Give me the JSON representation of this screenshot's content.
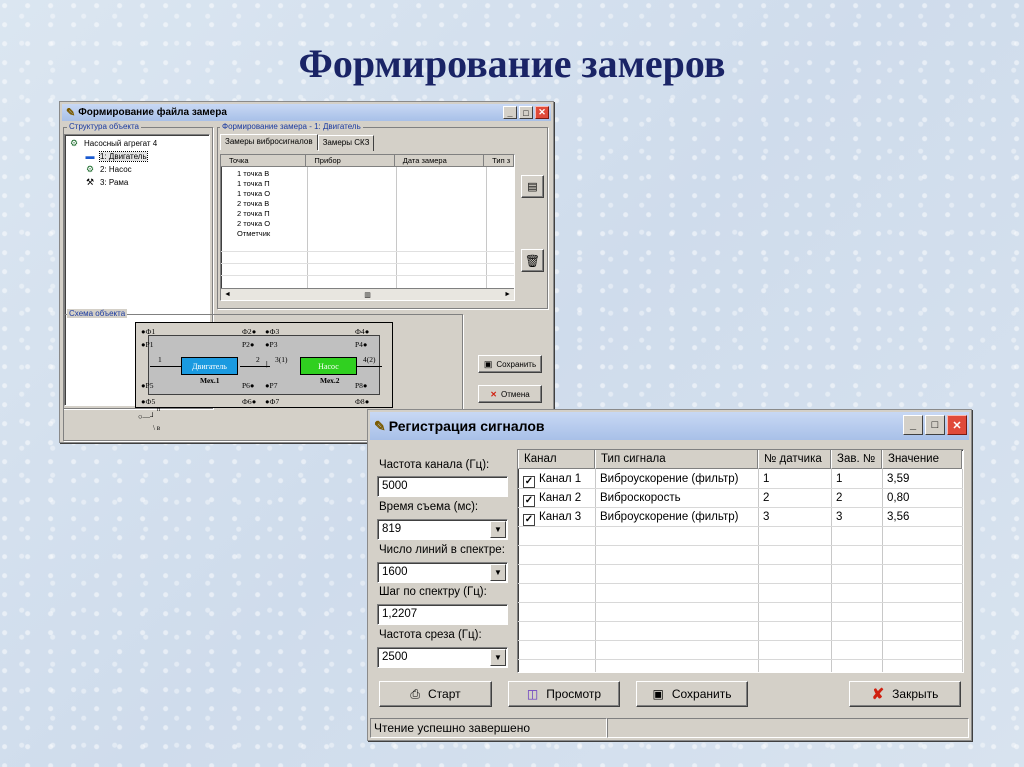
{
  "slide": {
    "title": "Формирование замеров"
  },
  "window1": {
    "title": "Формирование файла замера",
    "structure_label": "Структура объекта",
    "tree": {
      "root": "Насосный агрегат 4",
      "children": [
        "1: Двигатель",
        "2: Насос",
        "3: Рама"
      ]
    },
    "form_label": "Формирование замера -  1: Двигатель",
    "tabs": [
      "Замеры вибросигналов",
      "Замеры СКЗ"
    ],
    "grid_headers": [
      "Точка",
      "Прибор",
      "Дата замера",
      "Тип з"
    ],
    "points": [
      "1 точка В",
      "1 точка П",
      "1 точка О",
      "2 точка В",
      "2 точка П",
      "2 точка О",
      "Отметчик"
    ],
    "scheme_label": "Схема объекта",
    "scheme": {
      "top_labels": [
        "Ф1",
        "Ф2",
        "Ф3",
        "Ф4"
      ],
      "p_top": [
        "P1",
        "P2",
        "P3",
        "P4"
      ],
      "p_bottom": [
        "P5",
        "P6",
        "P7",
        "P8"
      ],
      "bottom_labels": [
        "Ф5",
        "Ф6",
        "Ф7",
        "Ф8"
      ],
      "nodes": [
        "1",
        "2",
        "3(1)",
        "4(2)"
      ],
      "box1": "Двигатель",
      "box2": "Насос",
      "mech1": "Мех.1",
      "mech2": "Мех.2",
      "switch_p": "п",
      "switch_v": "в"
    },
    "save_label": "Сохранить",
    "cancel_label": "Отмена"
  },
  "window2": {
    "title": "Регистрация сигналов",
    "fields": {
      "channel_freq_label": "Частота канала (Гц):",
      "channel_freq_value": "5000",
      "time_label": "Время съема (мс):",
      "time_value": "819",
      "lines_label": "Число линий в спектре:",
      "lines_value": "1600",
      "step_label": "Шаг по спектру (Гц):",
      "step_value": "1,2207",
      "cutoff_label": "Частота среза (Гц):",
      "cutoff_value": "2500"
    },
    "table": {
      "headers": [
        "Канал",
        "Тип сигнала",
        "№ датчика",
        "Зав. №",
        "Значение"
      ],
      "rows": [
        {
          "channel": "Канал 1",
          "type": "Виброускорение (фильтр)",
          "sensor": "1",
          "serial": "1",
          "value": "3,59"
        },
        {
          "channel": "Канал 2",
          "type": "Виброскорость",
          "sensor": "2",
          "serial": "2",
          "value": "0,80"
        },
        {
          "channel": "Канал 3",
          "type": "Виброускорение (фильтр)",
          "sensor": "3",
          "serial": "3",
          "value": "3,56"
        }
      ]
    },
    "buttons": {
      "start": "Старт",
      "view": "Просмотр",
      "save": "Сохранить",
      "close": "Закрыть"
    },
    "status": "Чтение успешно завершено"
  }
}
